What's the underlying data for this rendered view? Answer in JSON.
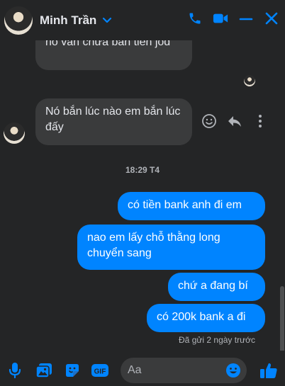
{
  "header": {
    "name": "Minh Trần",
    "icons": [
      "chevron-down-icon",
      "phone-icon",
      "video-icon",
      "minimize-icon",
      "close-icon"
    ]
  },
  "messages": {
    "m1": "nó vẫn chưa bắn tiền jod",
    "m2": "Nó bắn lúc nào em bắn lúc đấy",
    "timestamp": "18:29 T4",
    "o1": "có tiền bank anh đi em",
    "o2": "nao em lấy chỗ thằng long chuyển sang",
    "o3": "chứ a đang bí",
    "o4": "có 200k bank a đi",
    "status": "Đã gửi 2 ngày trước"
  },
  "composer": {
    "placeholder": "Aa",
    "icons": [
      "microphone-icon",
      "image-icon",
      "sticker-icon",
      "gif-icon",
      "emoji-icon",
      "like-icon"
    ]
  },
  "colors": {
    "accent": "#0084ff",
    "incoming_bubble": "#3a3b3c",
    "background": "#242526"
  }
}
